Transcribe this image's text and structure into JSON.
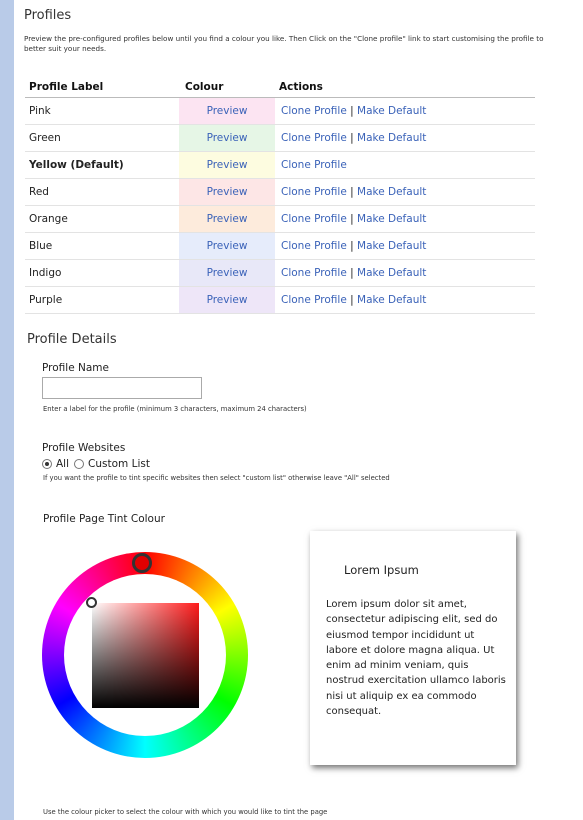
{
  "profiles_section": {
    "title": "Profiles",
    "intro": "Preview the pre-configured profiles below until you find a colour you like. Then Click on the \"Clone profile\" link to start customising the profile to better suit your needs."
  },
  "table": {
    "headers": {
      "label": "Profile Label",
      "colour": "Colour",
      "actions": "Actions"
    },
    "preview_label": "Preview",
    "clone_label": "Clone Profile",
    "separator": "|",
    "make_default_label": "Make Default",
    "rows": [
      {
        "label": "Pink",
        "tint": "#fce4f2",
        "is_default": false
      },
      {
        "label": "Green",
        "tint": "#e6f6e6",
        "is_default": false
      },
      {
        "label": "Yellow (Default)",
        "tint": "#fdfce0",
        "is_default": true
      },
      {
        "label": "Red",
        "tint": "#fde6e6",
        "is_default": false
      },
      {
        "label": "Orange",
        "tint": "#fdebdc",
        "is_default": false
      },
      {
        "label": "Blue",
        "tint": "#e6ecfb",
        "is_default": false
      },
      {
        "label": "Indigo",
        "tint": "#e8e8f8",
        "is_default": false
      },
      {
        "label": "Purple",
        "tint": "#eee6f8",
        "is_default": false
      }
    ]
  },
  "details": {
    "title": "Profile Details",
    "name_label": "Profile Name",
    "name_value": "",
    "name_help": "Enter a label for the profile (minimum 3 characters, maximum 24 characters)",
    "websites_label": "Profile Websites",
    "option_all": "All",
    "option_custom": "Custom List",
    "selected_option": "All",
    "websites_help": "If you want the profile to tint specific websites then select \"custom list\" otherwise leave \"All\" selected",
    "tint_label": "Profile Page Tint Colour",
    "selected_colour": "#e00000",
    "picker_help": "Use the colour picker to select the colour with which you would like to tint the page"
  },
  "preview_card": {
    "title": "Lorem Ipsum",
    "body": "Lorem ipsum dolor sit amet, consectetur adipiscing elit, sed do eiusmod tempor incididunt ut labore et dolore magna aliqua. Ut enim ad minim veniam, quis nostrud exercitation ullamco laboris nisi ut aliquip ex ea commodo consequat."
  }
}
